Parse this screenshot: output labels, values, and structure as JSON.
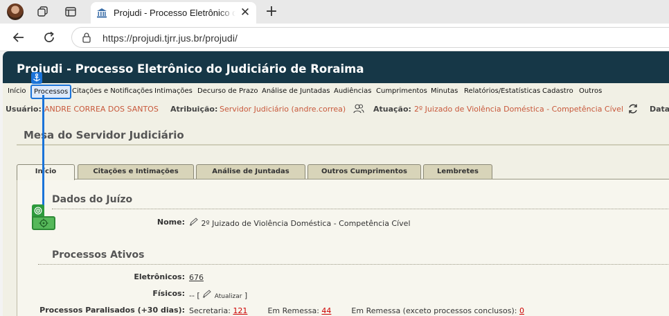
{
  "browser": {
    "tab_title": "Projudi - Processo Eletrônico do Judiciário de Roraima",
    "url": "https://projudi.tjrr.jus.br/projudi/"
  },
  "site": {
    "title": "Projudi - Processo Eletrônico do Judiciário de Roraima"
  },
  "menu": {
    "items": [
      "Início",
      "Processos",
      "Citações e Notificações",
      "Intimações",
      "Decurso de Prazo",
      "Análise de Juntadas",
      "Audiências",
      "Cumprimentos",
      "Minutas",
      "Relatórios/Estatísticas",
      "Cadastro",
      "Outros"
    ],
    "active": "Processos"
  },
  "userbar": {
    "usuario_label": "Usuário:",
    "usuario_value": "ANDRE CORREA DOS SANTOS",
    "atribuicao_label": "Atribuição:",
    "atribuicao_value": "Servidor Judiciário (andre.correa)",
    "atuacao_label": "Atuação:",
    "atuacao_value": "2º Juizado de Violência Doméstica - Competência Cível",
    "data_label": "Data"
  },
  "panel": {
    "title": "Mesa do Servidor Judiciário",
    "tabs": [
      "Início",
      "Citações e Intimações",
      "Análise de Juntadas",
      "Outros Cumprimentos",
      "Lembretes"
    ],
    "active_tab": "Início"
  },
  "dados_juizo": {
    "title": "Dados do Juízo",
    "nome_label": "Nome:",
    "nome_value": "2º Juizado de Violência Doméstica - Competência Cível"
  },
  "processos_ativos": {
    "title": "Processos Ativos",
    "eletronicos_label": "Eletrônicos:",
    "eletronicos_value": "676",
    "fisicos_label": "Físicos:",
    "fisicos_prefix": "-- [",
    "atualizar_label": "Atualizar",
    "fisicos_suffix": "]",
    "paralisados_label": "Processos Paralisados (+30 dias):",
    "secretaria_label": "Secretaria:",
    "secretaria_value": "121",
    "remessa_label": "Em Remessa:",
    "remessa_value": "44",
    "remessa_exceto_label": "Em Remessa (exceto processos conclusos):",
    "remessa_exceto_value": "0"
  },
  "colors": {
    "header_bg": "#163747",
    "accent_orange": "#c8583b",
    "link_red": "#cc0000",
    "annotation_blue": "#1a73d9",
    "annotation_green": "#2d9a3c"
  }
}
